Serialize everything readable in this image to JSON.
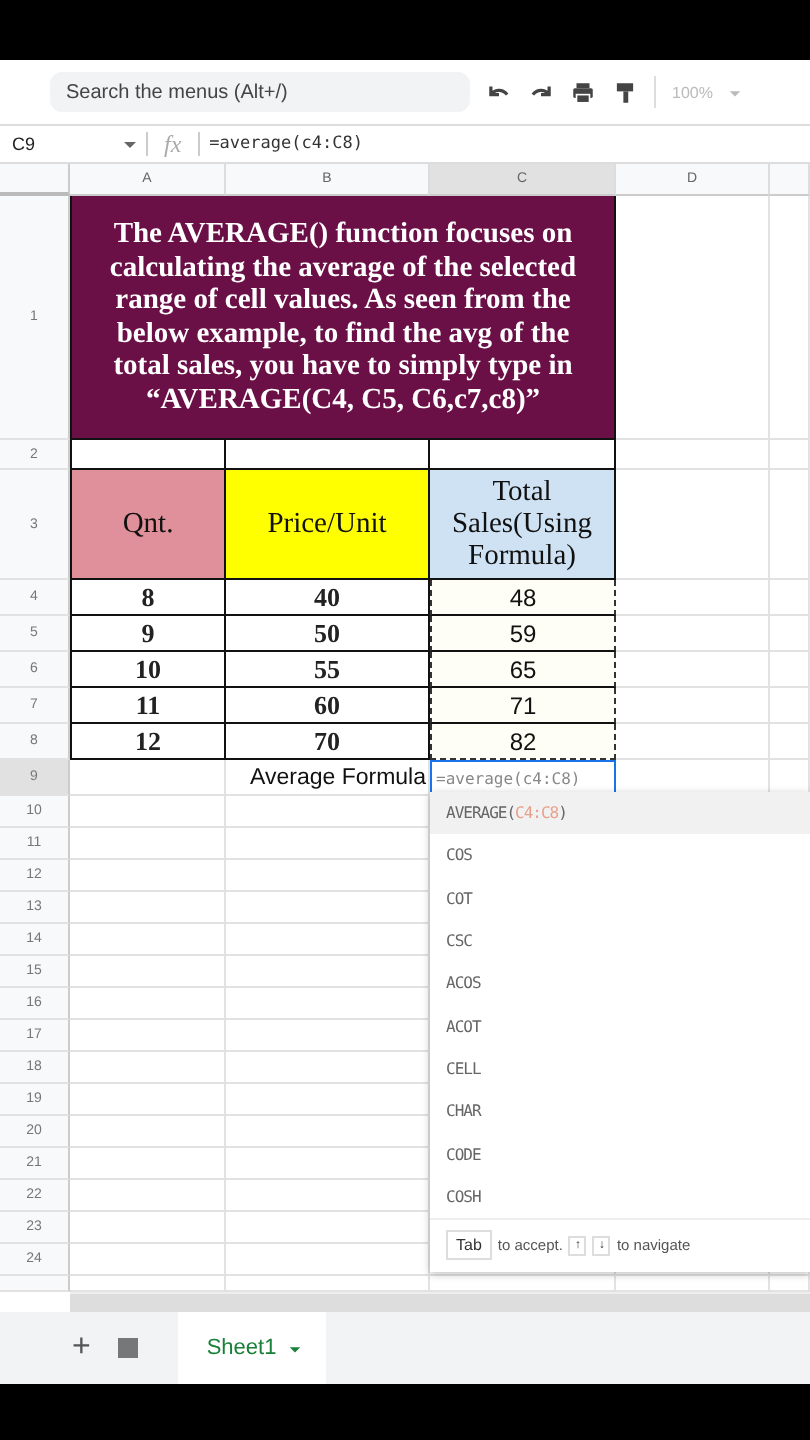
{
  "toolbar": {
    "search": {
      "placeholder": "Search the menus (Alt+/)"
    },
    "zoom": "100%"
  },
  "formula_bar": {
    "cell_ref": "C9",
    "fx": "fx",
    "formula": "=average(c4:C8)"
  },
  "columns": [
    {
      "label": "A",
      "selected": false
    },
    {
      "label": "B",
      "selected": false
    },
    {
      "label": "C",
      "selected": true
    },
    {
      "label": "D",
      "selected": false
    }
  ],
  "sheet": {
    "description": "The AVERAGE() function focuses on calculating the average of the selected range of cell values. As seen from the below example, to find the avg of the total sales, you have to simply type in “AVERAGE(C4, C5, C6,c7,c8)”",
    "headers": [
      {
        "text": "Qnt.",
        "color": "#e0909a"
      },
      {
        "text": "Price/Unit",
        "color": "#ffff00"
      },
      {
        "text": "Total Sales(Using Formula)",
        "color": "#cfe2f3"
      }
    ],
    "rows": [
      [
        "8",
        "40",
        "48"
      ],
      [
        "9",
        "50",
        "59"
      ],
      [
        "10",
        "55",
        "65"
      ],
      [
        "11",
        "60",
        "71"
      ],
      [
        "12",
        "70",
        "82"
      ]
    ],
    "average_label": "Average Formula",
    "editing_value": "=average(c4:C8)"
  },
  "row_numbers": [
    {
      "label": "1",
      "selected": false
    },
    {
      "label": "2",
      "selected": false
    },
    {
      "label": "3",
      "selected": false
    },
    {
      "label": "4",
      "selected": false
    },
    {
      "label": "5",
      "selected": false
    },
    {
      "label": "6",
      "selected": false
    },
    {
      "label": "7",
      "selected": false
    },
    {
      "label": "8",
      "selected": false
    },
    {
      "label": "9",
      "selected": true
    },
    {
      "label": "10",
      "selected": false
    },
    {
      "label": "11",
      "selected": false
    },
    {
      "label": "12",
      "selected": false
    },
    {
      "label": "13",
      "selected": false
    },
    {
      "label": "14",
      "selected": false
    },
    {
      "label": "15",
      "selected": false
    },
    {
      "label": "16",
      "selected": false
    },
    {
      "label": "17",
      "selected": false
    },
    {
      "label": "18",
      "selected": false
    },
    {
      "label": "19",
      "selected": false
    },
    {
      "label": "20",
      "selected": false
    },
    {
      "label": "21",
      "selected": false
    },
    {
      "label": "22",
      "selected": false
    },
    {
      "label": "23",
      "selected": false
    },
    {
      "label": "24",
      "selected": false
    }
  ],
  "autocomplete": {
    "items": [
      {
        "name": "AVERAGE(",
        "args": "C4:C8",
        "close": ")",
        "selected": true
      },
      {
        "name": "COS",
        "selected": false
      },
      {
        "name": "COT",
        "selected": false
      },
      {
        "name": "CSC",
        "selected": false
      },
      {
        "name": "ACOS",
        "selected": false
      },
      {
        "name": "ACOT",
        "selected": false
      },
      {
        "name": "CELL",
        "selected": false
      },
      {
        "name": "CHAR",
        "selected": false
      },
      {
        "name": "CODE",
        "selected": false
      },
      {
        "name": "COSH",
        "selected": false
      }
    ],
    "hint": {
      "key": "Tab",
      "accept": "to accept.",
      "up": "↑",
      "down": "↓",
      "navigate": "to navigate"
    }
  },
  "sheet_tabs": [
    {
      "label": "Sheet1",
      "selected": true
    }
  ],
  "tab_bar": {
    "add": "+"
  }
}
